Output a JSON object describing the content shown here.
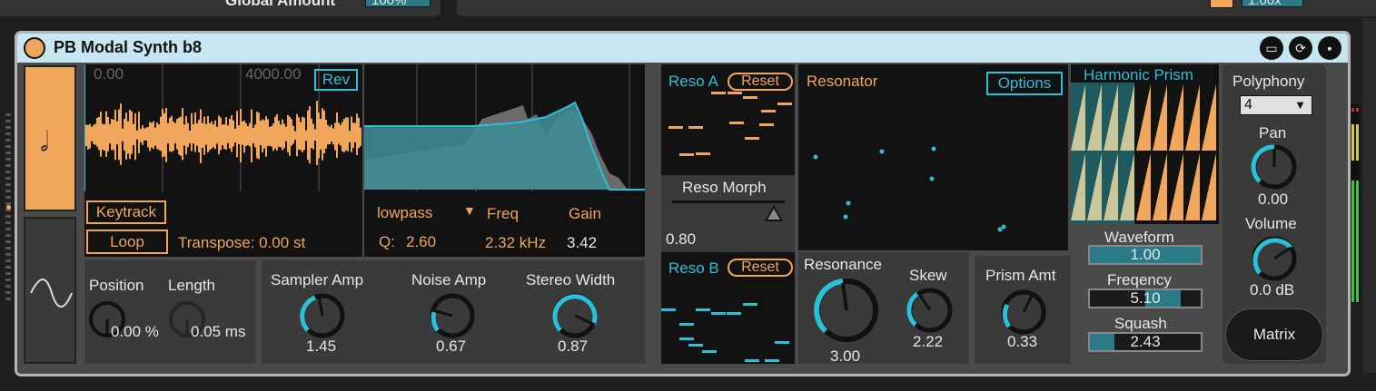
{
  "top": {
    "global_label": "Global Amount",
    "global_value": "100%",
    "right_value": "1.00x"
  },
  "device": {
    "title": "PB Modal Synth b8"
  },
  "sampler": {
    "start": "0.00",
    "end": "4000.00",
    "rev": "Rev",
    "keytrack": "Keytrack",
    "loop": "Loop",
    "transpose": "Transpose: 0.00 st"
  },
  "filter": {
    "type": "lowpass",
    "freq_label": "Freq",
    "gain_label": "Gain",
    "q_label": "Q:",
    "q": "2.60",
    "freq": "2.32 kHz",
    "gain": "3.42"
  },
  "position": {
    "position_label": "Position",
    "length_label": "Length",
    "position": "0.00 %",
    "length": "0.05 ms"
  },
  "amps": {
    "sampler_label": "Sampler Amp",
    "sampler": "1.45",
    "noise_label": "Noise Amp",
    "noise": "0.67",
    "stereo_label": "Stereo Width",
    "stereo": "0.87"
  },
  "reso": {
    "a_label": "Reso A",
    "b_label": "Reso B",
    "reset": "Reset",
    "morph_label": "Reso Morph",
    "morph": "0.80"
  },
  "resonator": {
    "title": "Resonator",
    "options": "Options",
    "resonance_label": "Resonance",
    "resonance": "3.00",
    "skew_label": "Skew",
    "skew": "2.22"
  },
  "prism": {
    "title": "Harmonic Prism",
    "amt_label": "Prism Amt",
    "amt": "0.33",
    "waveform_label": "Waveform",
    "waveform": "1.00",
    "freq_label": "Freqency",
    "freq": "5.10",
    "squash_label": "Squash",
    "squash": "2.43"
  },
  "output": {
    "poly_label": "Polyphony",
    "poly": "4",
    "pan_label": "Pan",
    "pan": "0.00",
    "volume_label": "Volume",
    "volume": "0.0 dB",
    "matrix": "Matrix"
  },
  "colors": {
    "orange": "#f0a75b",
    "cyan": "#2bbfd8",
    "teal": "#2b7a87",
    "title_bg": "#c6e6f1"
  }
}
